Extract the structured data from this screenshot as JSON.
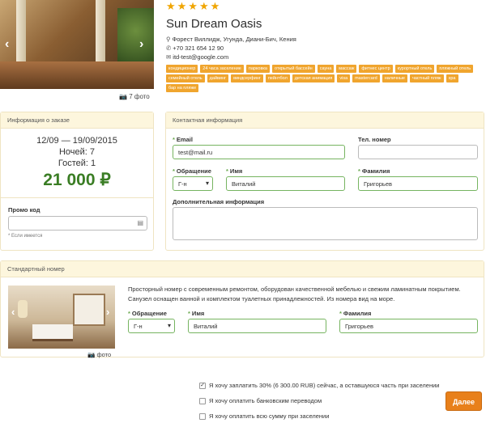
{
  "hotel": {
    "stars": "★★★★★",
    "name": "Sun Dream Oasis",
    "address": "Форест Виллидж, Угунда, Диани-Бич, Кения",
    "phone": "+70 321 654 12 90",
    "email": "itd-test@google.com",
    "photo_count": "7 фото",
    "tags": [
      "кондиционер",
      "24 часа заселение",
      "парковка",
      "открытый бассейн",
      "сауна",
      "массаж",
      "фитнес центр",
      "курортный отель",
      "пляжный отель",
      "семейный отель",
      "дайвинг",
      "виндсерфинг",
      "пейнтбол",
      "детская анимация",
      "visa",
      "mastercard",
      "наличные",
      "частный пляж",
      "spa",
      "бар на пляже"
    ]
  },
  "order": {
    "header": "Информация о заказе",
    "dates": "12/09 — 19/09/2015",
    "nights": "Ночей: 7",
    "guests": "Гостей: 1",
    "price": "21 000 ₽",
    "promo_label": "Промо код",
    "promo_note": "* Если имеется"
  },
  "contact": {
    "header": "Контактная информация",
    "email_label": "Email",
    "email_value": "test@mail.ru",
    "phone_label": "Тел. номер",
    "title_label": "Обращение",
    "title_value": "Г-н",
    "name_label": "Имя",
    "name_value": "Виталий",
    "surname_label": "Фамилия",
    "surname_value": "Григорьев",
    "extra_label": "Дополнительная информация"
  },
  "room": {
    "header": "Стандартный номер",
    "description": "Просторный номер с современным ремонтом, оборудован качественной мебелью и свежим ламинатным покрытием. Санузел оснащен ванной и комплектом туалетных принадлежностей. Из номера вид на море.",
    "photo_label": "фото",
    "title_label": "Обращение",
    "title_value": "Г-н",
    "name_label": "Имя",
    "name_value": "Виталий",
    "surname_label": "Фамилия",
    "surname_value": "Григорьев"
  },
  "payment": {
    "option1": "Я хочу заплатить 30% (6 300.00 RUB) сейчас, а оставшуюся часть при заселении",
    "option2": "Я хочу оплатить банковским переводом",
    "option3": "Я хочу оплатить всю сумму при заселении",
    "next": "Далее"
  },
  "colors": {
    "accent": "#e8801b",
    "price": "#3a7d24",
    "tag": "#f0a52e",
    "panel_head": "#fdf6dd"
  }
}
